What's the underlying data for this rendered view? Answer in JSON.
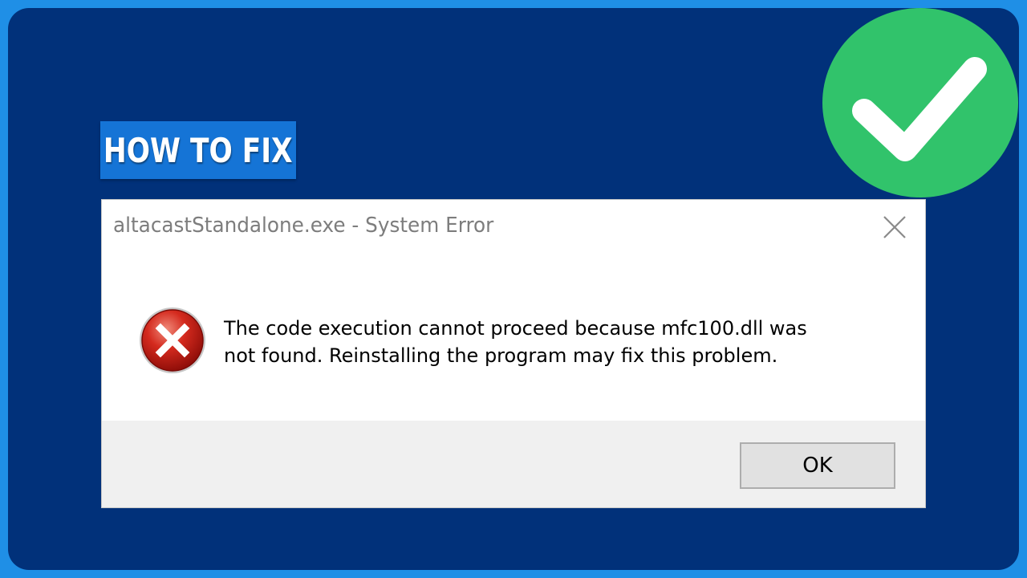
{
  "thumbnail": {
    "badge_text": "HOW TO FIX",
    "check_icon": "check-circle-icon",
    "colors": {
      "outer_border": "#1f8fe6",
      "background": "#01317a",
      "badge": "#1574d6",
      "check_green": "#31c36b"
    }
  },
  "dialog": {
    "title": "altacastStandalone.exe - System Error",
    "close_icon": "close-icon",
    "error_icon": "error-icon",
    "message_line1": "The code execution cannot proceed because mfc100.dll was",
    "message_line2": "not found. Reinstalling the program may fix this problem.",
    "ok_label": "OK"
  }
}
